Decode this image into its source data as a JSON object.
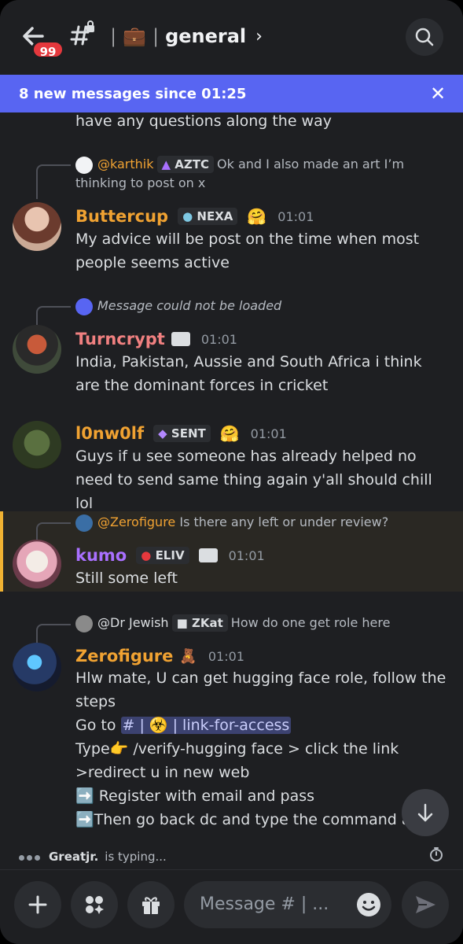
{
  "header": {
    "unread_count": "99",
    "separator": "|",
    "channel_emoji": "💼",
    "channel_name": "general",
    "chevron": "›"
  },
  "banner": {
    "text": "8 new messages since 01:25",
    "close": "✕"
  },
  "messages": {
    "partial_text": "have any questions along the way",
    "m1": {
      "reply_name": "@karthik",
      "reply_tag": "AZTC",
      "reply_text": "Ok and I also made an art I’m thinking to post on x",
      "name": "Buttercup",
      "tag": "NEXA",
      "badge_emoji": "🤗",
      "time": "01:01",
      "text": "My advice will be post on the time when most people seems active"
    },
    "m2": {
      "reply_text": "Message could not be loaded",
      "name": "Turncrypt",
      "time": "01:01",
      "text": "India, Pakistan, Aussie and South Africa i think are the dominant forces in cricket"
    },
    "m3": {
      "name": "l0nw0lf",
      "tag": "SENT",
      "badge_emoji": "🤗",
      "time": "01:01",
      "text": "Guys if u see someone has already helped no need to send same thing again y'all should chill lol"
    },
    "m4": {
      "reply_name": "@Zerofigure",
      "reply_text": "Is there any left or under review?",
      "name": "kumo",
      "tag": "ELIV",
      "time": "01:01",
      "text": "Still some left"
    },
    "m5": {
      "reply_name": "@Dr Jewish",
      "reply_tag": "ZKat",
      "reply_text": "How do one get role here",
      "name": "Zerofigure",
      "badge_emoji": "🧸",
      "time": "01:01",
      "line1": "Hlw mate, U can get hugging face role, follow the steps",
      "line2_prefix": "Go to ",
      "line2_mention": "# | ☣️ | link-for-access",
      "line3": "Type👉  /verify-hugging face  > click the link >redirect u in new web",
      "line4": "➡️ Register with email and pass",
      "line5": "➡️Then go back dc and type the command again"
    }
  },
  "typing": {
    "user": "Greatjr.",
    "suffix": "is typing..."
  },
  "composer": {
    "placeholder": "Message # | ..."
  },
  "colors": {
    "accent": "#5865f2",
    "badge_red": "#e5383d",
    "buttercup": "#f0a232",
    "turncrypt": "#f08080",
    "l0nw0lf": "#f0a232",
    "kumo": "#a970ff",
    "zerofigure": "#f0a232"
  }
}
